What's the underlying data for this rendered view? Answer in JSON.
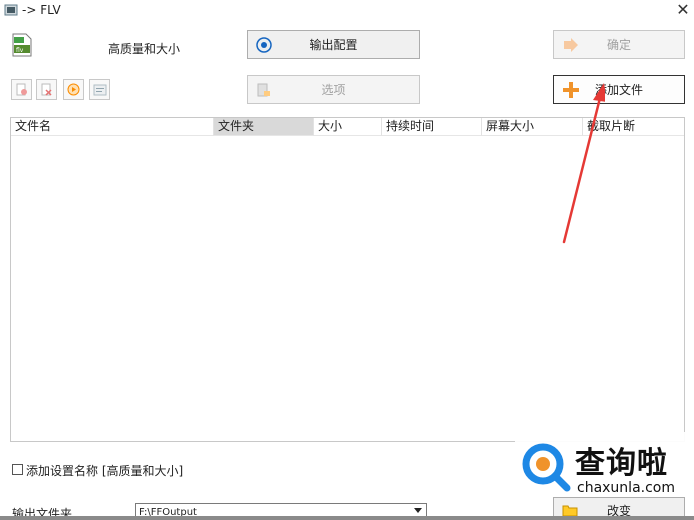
{
  "window": {
    "title": "-> FLV"
  },
  "profile": {
    "label": "高质量和大小"
  },
  "buttons": {
    "output_config": "输出配置",
    "ok": "确定",
    "options": "选项",
    "add_file": "添加文件",
    "change": "改变"
  },
  "table": {
    "columns": [
      "文件名",
      "文件夹",
      "大小",
      "持续时间",
      "屏幕大小",
      "截取片断"
    ],
    "rows": []
  },
  "bottom": {
    "add_setting_name_label": "添加设置名称 [高质量和大小]",
    "add_setting_name_checked": false,
    "output_folder_label": "输出文件夹",
    "output_folder_value": "F:\\FFOutput"
  },
  "watermark": {
    "text": "查询啦",
    "url": "chaxunla.com"
  },
  "colors": {
    "annotation_arrow": "#e53935",
    "add_icon": "#f0932b",
    "watermark_accent": "#1e88e5"
  }
}
